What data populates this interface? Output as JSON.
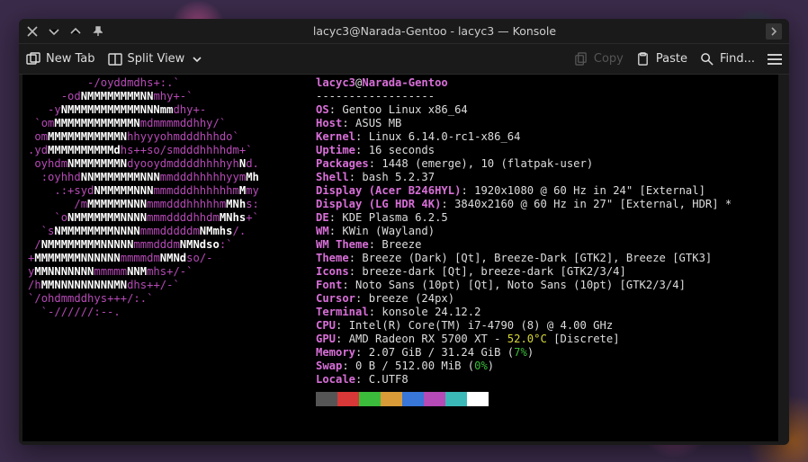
{
  "window": {
    "title": "lacyc3@Narada-Gentoo - lacyc3 — Konsole"
  },
  "toolbar": {
    "new_tab": "New Tab",
    "split_view": "Split View",
    "copy": "Copy",
    "paste": "Paste",
    "find": "Find..."
  },
  "header": {
    "user": "lacyc3",
    "at": "@",
    "host": "Narada-Gentoo",
    "separator": "------------------"
  },
  "info": {
    "os": {
      "label": "OS",
      "value": ": Gentoo Linux x86_64"
    },
    "host": {
      "label": "Host",
      "value": ": ASUS MB"
    },
    "kernel": {
      "label": "Kernel",
      "value": ": Linux 6.14.0-rc1-x86_64"
    },
    "uptime": {
      "label": "Uptime",
      "value": ": 16 seconds"
    },
    "packages": {
      "label": "Packages",
      "value": ": 1448 (emerge), 10 (flatpak-user)"
    },
    "shell": {
      "label": "Shell",
      "value": ": bash 5.2.37"
    },
    "display1": {
      "label": "Display (Acer B246HYL)",
      "value": ": 1920x1080 @ 60 Hz in 24\" [External]"
    },
    "display2": {
      "label": "Display (LG HDR 4K)",
      "value": ": 3840x2160 @ 60 Hz in 27\" [External, HDR] *"
    },
    "de": {
      "label": "DE",
      "value": ": KDE Plasma 6.2.5"
    },
    "wm": {
      "label": "WM",
      "value": ": KWin (Wayland)"
    },
    "wmtheme": {
      "label": "WM Theme",
      "value": ": Breeze"
    },
    "theme": {
      "label": "Theme",
      "value": ": Breeze (Dark) [Qt], Breeze-Dark [GTK2], Breeze [GTK3]"
    },
    "icons": {
      "label": "Icons",
      "value": ": breeze-dark [Qt], breeze-dark [GTK2/3/4]"
    },
    "font": {
      "label": "Font",
      "value": ": Noto Sans (10pt) [Qt], Noto Sans (10pt) [GTK2/3/4]"
    },
    "cursor": {
      "label": "Cursor",
      "value": ": breeze (24px)"
    },
    "terminal": {
      "label": "Terminal",
      "value": ": konsole 24.12.2"
    },
    "cpu": {
      "label": "CPU",
      "value": ": Intel(R) Core(TM) i7-4790 (8) @ 4.00 GHz"
    },
    "gpu": {
      "label": "GPU",
      "value_pre": ": AMD Radeon RX 5700 XT - ",
      "temp": "52.0°C",
      "value_post": " [Discrete]"
    },
    "memory": {
      "label": "Memory",
      "value_pre": ": 2.07 GiB / 31.24 GiB (",
      "pct": "7%",
      "value_post": ")"
    },
    "swap": {
      "label": "Swap",
      "value_pre": ": 0 B / 512.00 MiB (",
      "pct": "0%",
      "value_post": ")"
    },
    "locale": {
      "label": "Locale",
      "value": ": C.UTF8"
    }
  },
  "palette_colors": [
    "#555555",
    "#d83838",
    "#3bbd3b",
    "#d89b38",
    "#3876d8",
    "#b64ab6",
    "#3bb8b8",
    "#ffffff"
  ],
  "ascii_art": [
    [
      "         ",
      "-/",
      "oy",
      "ddmdhs",
      "+:",
      ".",
      "`                "
    ],
    [
      "     ",
      "-o",
      "d",
      "NMMMMMMMMNN",
      "mhy",
      "+",
      "-`              "
    ],
    [
      "   ",
      "-y",
      "NMMMMMMMMMMMNNNmm",
      "dhy",
      "+",
      "-               "
    ],
    [
      " `",
      "o",
      "m",
      "MMMMMMMMMMMMN",
      "m",
      "d",
      "mmmm",
      "ddhhy",
      "/",
      "`"
    ],
    [
      " ",
      "om",
      "MMMMMMMMMMMN",
      "hhyyyo",
      "hmdddhhhd",
      "o",
      "`        "
    ],
    [
      ".",
      "y",
      "d",
      "MMMMMMMMMMd",
      "hs++so/s",
      "mdddhhhhd",
      "m",
      "+",
      "`"
    ],
    [
      " ",
      "oy",
      "hdm",
      "NMMMMMMMN",
      "dyooy",
      "dmddddhhhhyh",
      "N",
      "d.   "
    ],
    [
      "  ",
      ":o",
      "yhhd",
      "NNMMMMMMMNNN",
      "mm",
      "dddhhhhhyy",
      "m",
      "Mh  "
    ],
    [
      "    .",
      ":",
      "+sy",
      "d",
      "NMMMMMNNN",
      "mmm",
      "dddhhhhhhm",
      "M",
      "my"
    ],
    [
      "       ",
      "/m",
      "MMMMMMNNN",
      "mmm",
      "dddhhhhhm",
      "MNh",
      "s:     "
    ],
    [
      "    `",
      "o",
      "NMMMMMMMNNNN",
      "mmm",
      "ddddhhd",
      "m",
      "MNhs",
      "+",
      "`"
    ],
    [
      "  `",
      "s",
      "NMMMMMMMMNNNN",
      "mmm",
      "dddddm",
      "NMmhs",
      "/",
      ".    "
    ],
    [
      " ",
      "/",
      "N",
      "MMMMMMMMNNNNN",
      "mmm",
      "dddm",
      "NMNdso",
      ":",
      "`    "
    ],
    [
      "+",
      "M",
      "MMMMMMNNNNNN",
      "mmmmd",
      "m",
      "NMNd",
      "so",
      "/-          "
    ],
    [
      "y",
      "M",
      "MNNNNNNN",
      "mmmmm",
      "NNM",
      "mhs",
      "+/",
      "-`             "
    ],
    [
      "/",
      "h",
      "MMNNNNNNNNN",
      "M",
      "N",
      "dhs++",
      "/",
      "-`               "
    ],
    [
      "`",
      "/",
      "ohdmmddhys",
      "+++/:",
      ".",
      "`                         "
    ],
    [
      "  `",
      "-//////:--.                                       "
    ]
  ]
}
